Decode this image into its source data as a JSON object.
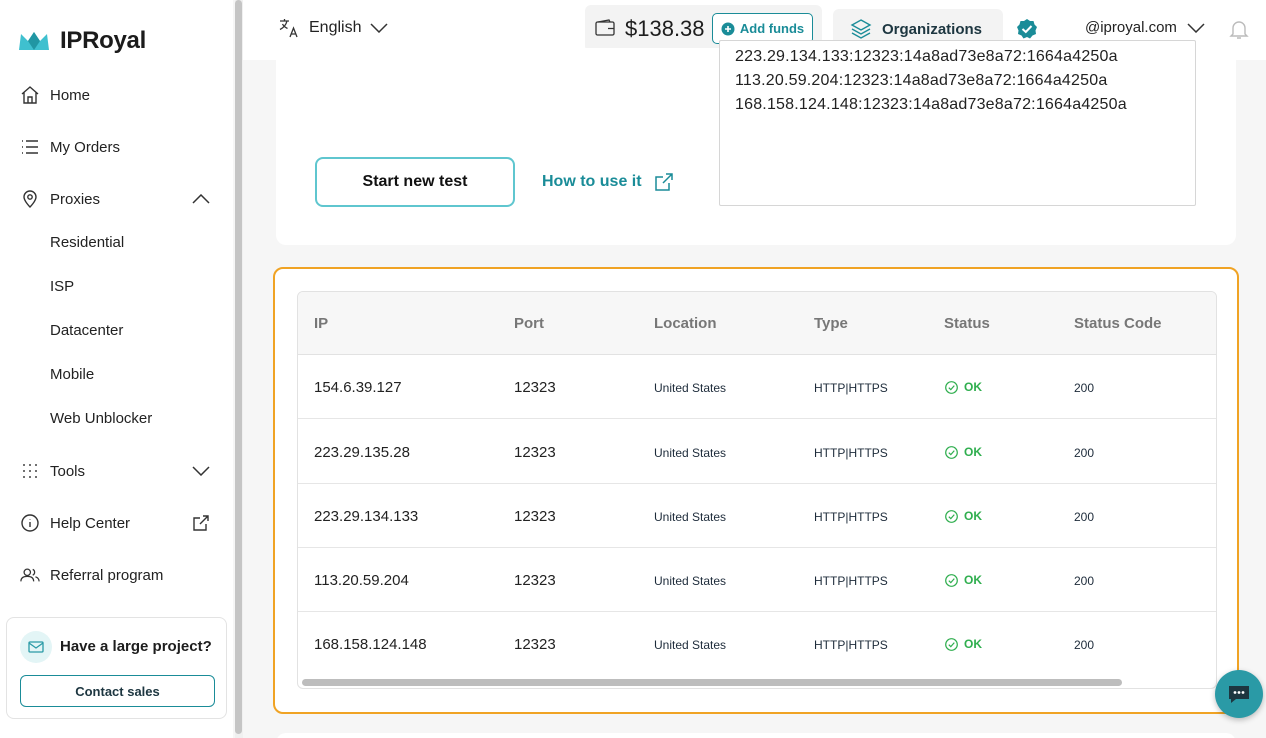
{
  "brand": {
    "name": "IPRoyal",
    "accent": "#1a8c98"
  },
  "sidebar": {
    "items": [
      {
        "label": "Home",
        "icon": "home-icon"
      },
      {
        "label": "My Orders",
        "icon": "list-icon"
      },
      {
        "label": "Proxies",
        "icon": "location-pin-icon"
      },
      {
        "label": "Tools",
        "icon": "grid-dots-icon"
      },
      {
        "label": "Help Center",
        "icon": "info-icon"
      },
      {
        "label": "Referral program",
        "icon": "users-icon"
      }
    ],
    "proxy_subitems": [
      "Residential",
      "ISP",
      "Datacenter",
      "Mobile",
      "Web Unblocker"
    ],
    "promo": {
      "title": "Have a large project?",
      "button": "Contact sales"
    }
  },
  "topbar": {
    "language": "English",
    "balance": "$138.38",
    "add_funds": "Add funds",
    "organizations": "Organizations",
    "account": "@iproyal.com"
  },
  "tester": {
    "start_button": "Start new test",
    "howto_link": "How to use it",
    "proxy_lines": [
      "223.29.134.133:12323:14a8ad73e8a72:1664a4250a",
      "113.20.59.204:12323:14a8ad73e8a72:1664a4250a",
      "168.158.124.148:12323:14a8ad73e8a72:1664a4250a"
    ]
  },
  "results": {
    "columns": [
      "IP",
      "Port",
      "Location",
      "Type",
      "Status",
      "Status Code"
    ],
    "rows": [
      {
        "ip": "154.6.39.127",
        "port": "12323",
        "location": "United States",
        "type": "HTTP|HTTPS",
        "status": "OK",
        "code": "200"
      },
      {
        "ip": "223.29.135.28",
        "port": "12323",
        "location": "United States",
        "type": "HTTP|HTTPS",
        "status": "OK",
        "code": "200"
      },
      {
        "ip": "223.29.134.133",
        "port": "12323",
        "location": "United States",
        "type": "HTTP|HTTPS",
        "status": "OK",
        "code": "200"
      },
      {
        "ip": "113.20.59.204",
        "port": "12323",
        "location": "United States",
        "type": "HTTP|HTTPS",
        "status": "OK",
        "code": "200"
      },
      {
        "ip": "168.158.124.148",
        "port": "12323",
        "location": "United States",
        "type": "HTTP|HTTPS",
        "status": "OK",
        "code": "200"
      }
    ]
  }
}
